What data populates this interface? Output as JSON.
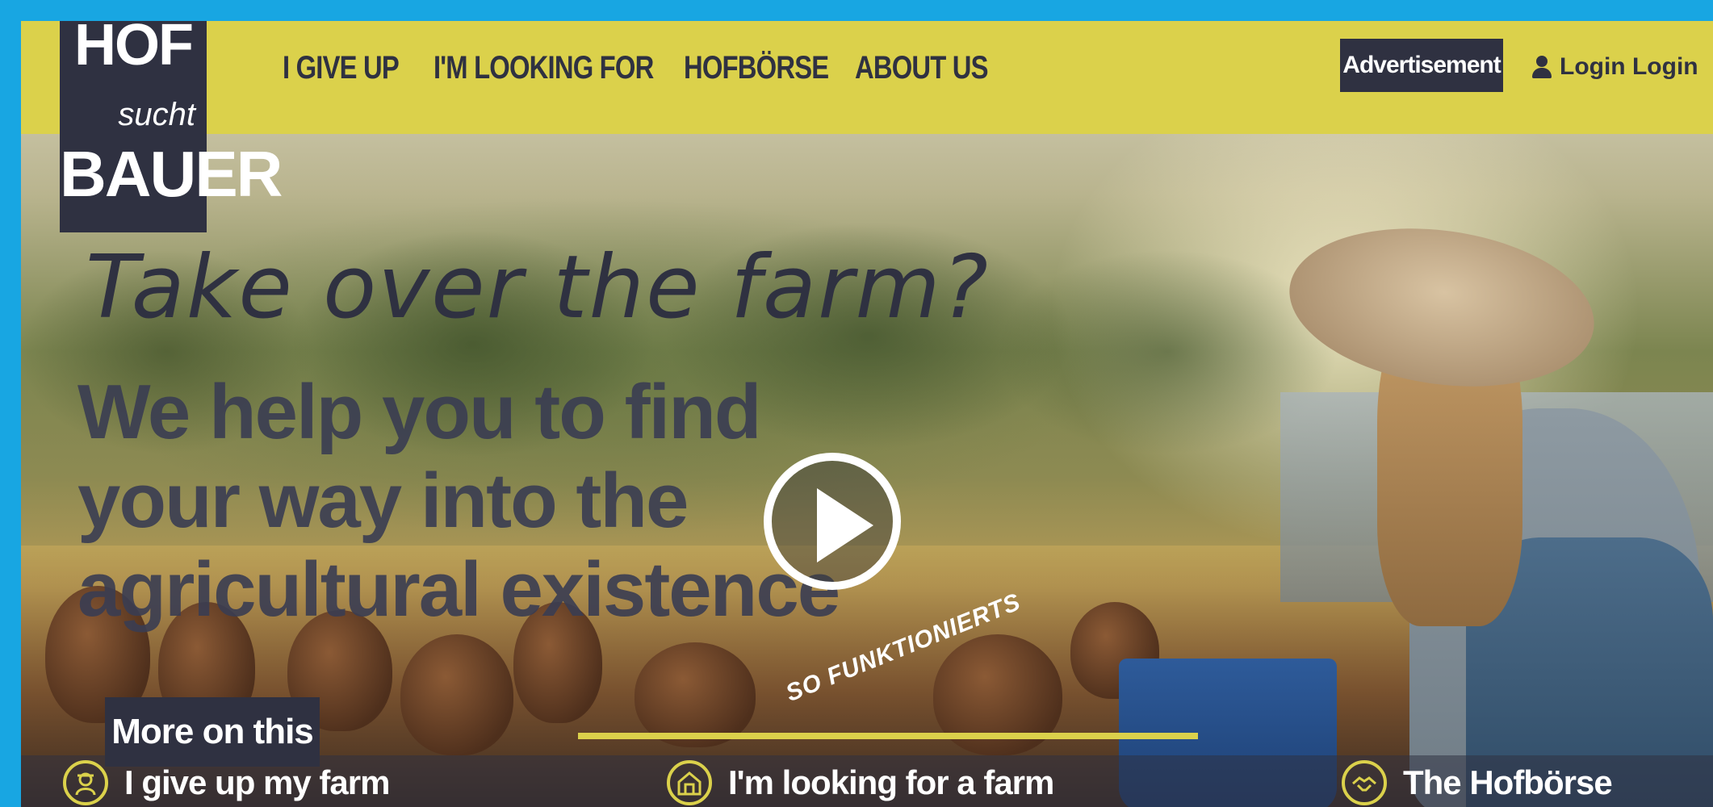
{
  "header": {
    "logo": {
      "line1": "HOF",
      "line2": "sucht",
      "line3": "BAUER"
    },
    "nav": [
      {
        "label": "I GIVE UP"
      },
      {
        "label": "I'M LOOKING FOR"
      },
      {
        "label": "HOFBÖRSE"
      },
      {
        "label": "ABOUT US"
      }
    ],
    "ad_label": "Advertisement",
    "login_label": "Login Login"
  },
  "hero": {
    "title": "Take over the farm?",
    "subtitle": "We help you to find your way into the agricultural existence",
    "video_label": "SO FUNKTIONIERTS"
  },
  "bottom": {
    "more_label": "More on this",
    "cards": [
      {
        "label": "I give up my farm",
        "icon": "farmer-icon"
      },
      {
        "label": "I'm looking for a farm",
        "icon": "barn-icon"
      },
      {
        "label": "The Hofbörse",
        "icon": "handshake-icon"
      }
    ]
  },
  "colors": {
    "accent": "#dbd14b",
    "dark": "#2f3141",
    "frame": "#18a6e2"
  }
}
